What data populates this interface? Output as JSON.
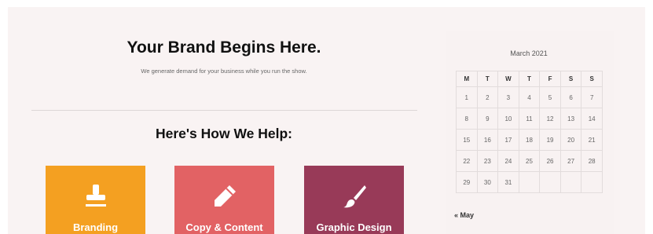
{
  "hero": {
    "title": "Your Brand Begins Here.",
    "subtitle": "We generate demand for your business while you run the show."
  },
  "help": {
    "title": "Here's How We Help:"
  },
  "services": [
    {
      "label": "Branding",
      "icon": "stamp-icon",
      "color": "#f4a021"
    },
    {
      "label": "Copy & Content",
      "icon": "pencil-icon",
      "color": "#e26264"
    },
    {
      "label": "Graphic Design",
      "icon": "paintbrush-icon",
      "color": "#983a58"
    }
  ],
  "calendar": {
    "caption": "March 2021",
    "weekdays": [
      "M",
      "T",
      "W",
      "T",
      "F",
      "S",
      "S"
    ],
    "weeks": [
      [
        "1",
        "2",
        "3",
        "4",
        "5",
        "6",
        "7"
      ],
      [
        "8",
        "9",
        "10",
        "11",
        "12",
        "13",
        "14"
      ],
      [
        "15",
        "16",
        "17",
        "18",
        "19",
        "20",
        "21"
      ],
      [
        "22",
        "23",
        "24",
        "25",
        "26",
        "27",
        "28"
      ],
      [
        "29",
        "30",
        "31",
        "",
        "",
        "",
        ""
      ]
    ],
    "prev_link": "« May"
  }
}
